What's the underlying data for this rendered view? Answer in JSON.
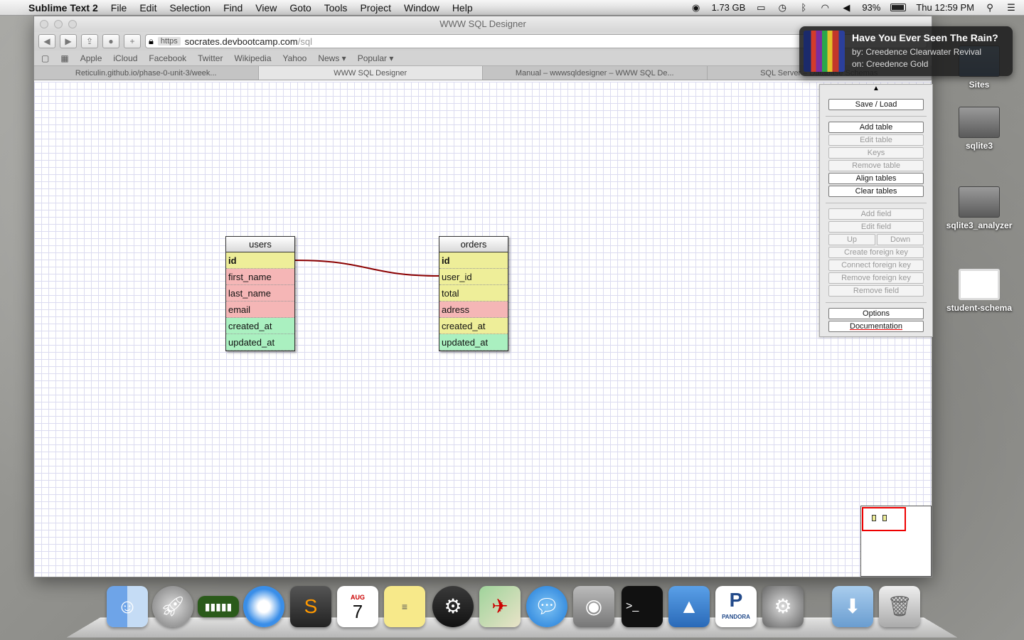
{
  "menubar": {
    "app_name": "Sublime Text 2",
    "items": [
      "File",
      "Edit",
      "Selection",
      "Find",
      "View",
      "Goto",
      "Tools",
      "Project",
      "Window",
      "Help"
    ],
    "memory": "1.73 GB",
    "battery": "93%",
    "clock": "Thu 12:59 PM"
  },
  "browser": {
    "window_title": "WWW SQL Designer",
    "url_protocol": "https",
    "url_host": "socrates.devbootcamp.com",
    "url_path": "/sql",
    "bookmarks": [
      "Apple",
      "iCloud",
      "Facebook",
      "Twitter",
      "Wikipedia",
      "Yahoo",
      "News ▾",
      "Popular ▾"
    ],
    "tabs": [
      "Reticulin.github.io/phase-0-unit-3/week...",
      "WWW SQL Designer",
      "Manual – wwwsqldesigner – WWW SQL De...",
      "SQL Server – Database Schemas"
    ]
  },
  "tables": [
    {
      "name": "users",
      "fields": [
        {
          "name": "id",
          "pk": true,
          "color": "#eeee99"
        },
        {
          "name": "first_name",
          "pk": false,
          "color": "#f5b6b6"
        },
        {
          "name": "last_name",
          "pk": false,
          "color": "#f5b6b6"
        },
        {
          "name": "email",
          "pk": false,
          "color": "#f5b6b6"
        },
        {
          "name": "created_at",
          "pk": false,
          "color": "#aaf0c0"
        },
        {
          "name": "updated_at",
          "pk": false,
          "color": "#aaf0c0"
        }
      ]
    },
    {
      "name": "orders",
      "fields": [
        {
          "name": "id",
          "pk": true,
          "color": "#eeee99"
        },
        {
          "name": "user_id",
          "pk": false,
          "color": "#eeee99"
        },
        {
          "name": "total",
          "pk": false,
          "color": "#eeee99"
        },
        {
          "name": "adress",
          "pk": false,
          "color": "#f5b6b6"
        },
        {
          "name": "created_at",
          "pk": false,
          "color": "#eeee99"
        },
        {
          "name": "updated_at",
          "pk": false,
          "color": "#aaf0c0"
        }
      ]
    }
  ],
  "controls": {
    "save_load": "Save / Load",
    "add_table": "Add table",
    "edit_table": "Edit table",
    "keys": "Keys",
    "remove_table": "Remove table",
    "align_tables": "Align tables",
    "clear_tables": "Clear tables",
    "add_field": "Add field",
    "edit_field": "Edit field",
    "up": "Up",
    "down": "Down",
    "create_fk": "Create foreign key",
    "connect_fk": "Connect foreign key",
    "remove_fk": "Remove foreign key",
    "remove_field": "Remove field",
    "options": "Options",
    "documentation": "Documentation"
  },
  "notification": {
    "title": "Have You Ever Seen The Rain?",
    "artist": "by: Creedence Clearwater Revival",
    "album": "on: Creedence Gold"
  },
  "desktop": {
    "icons": [
      "Sites",
      "sqlite3",
      "sqlite3_analyzer",
      "student-schema"
    ]
  },
  "dock": {
    "calendar_month": "AUG",
    "calendar_day": "7",
    "pandora": "PANDORA"
  },
  "colors": {
    "relation_line": "#8b0000",
    "minimap_view": "#ee0000"
  }
}
